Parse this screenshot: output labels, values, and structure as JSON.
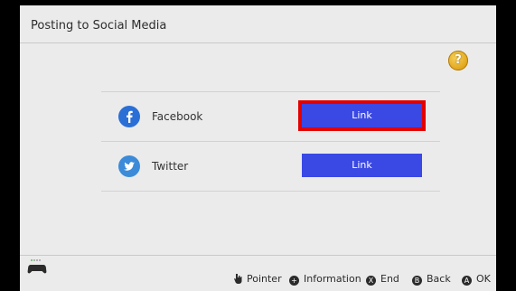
{
  "header": {
    "title": "Posting to Social Media"
  },
  "help": {
    "icon": "help-question-icon",
    "glyph": "?"
  },
  "services": [
    {
      "name": "Facebook",
      "icon": "facebook-icon",
      "button_label": "Link",
      "focused": true
    },
    {
      "name": "Twitter",
      "icon": "twitter-icon",
      "button_label": "Link",
      "focused": false
    }
  ],
  "footer": {
    "controller_icon": "controller-icon",
    "hints": [
      {
        "icon": "pointer-icon",
        "label": "Pointer"
      },
      {
        "icon": "plus-button-icon",
        "glyph": "+",
        "label": "Information"
      },
      {
        "icon": "x-button-icon",
        "glyph": "X",
        "label": "End"
      },
      {
        "icon": "b-button-icon",
        "glyph": "B",
        "label": "Back"
      },
      {
        "icon": "a-button-icon",
        "glyph": "A",
        "label": "OK"
      }
    ]
  },
  "colors": {
    "button": "#3a48e4",
    "focus": "#e30000",
    "panel": "#ebebeb"
  }
}
